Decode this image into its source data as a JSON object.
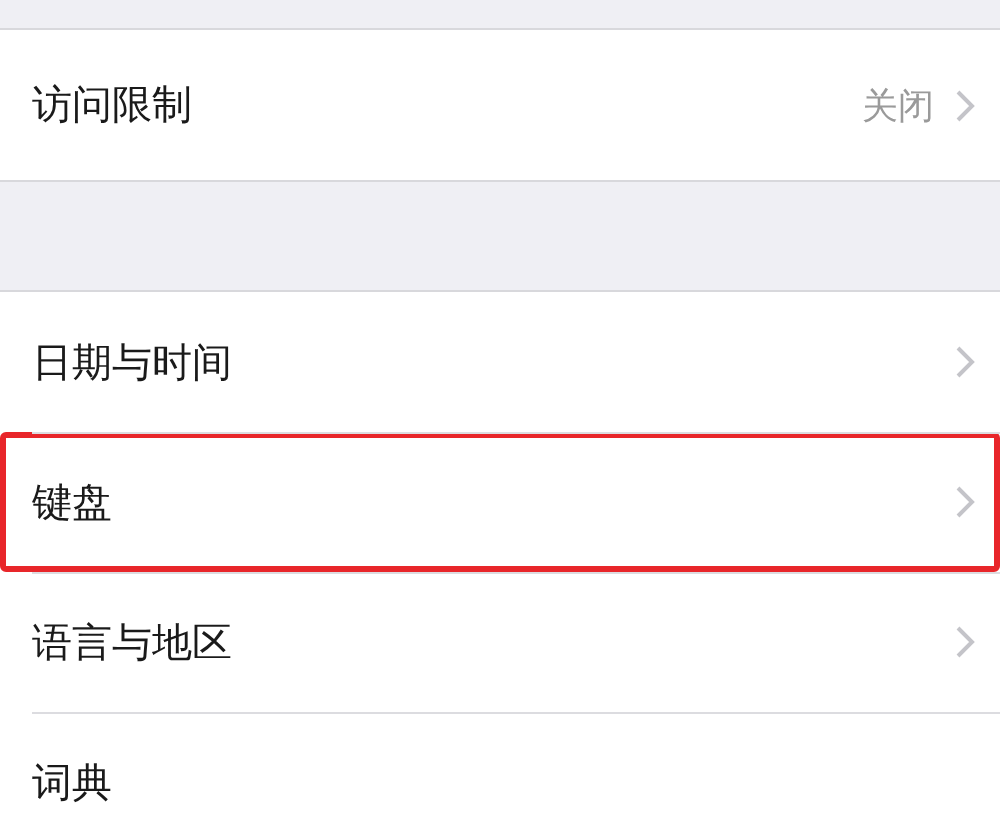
{
  "groups": [
    {
      "rows": [
        {
          "label": "访问限制",
          "value": "关闭",
          "chevron": true,
          "highlighted": false
        }
      ]
    },
    {
      "rows": [
        {
          "label": "日期与时间",
          "chevron": true,
          "highlighted": false
        },
        {
          "label": "键盘",
          "chevron": true,
          "highlighted": true
        },
        {
          "label": "语言与地区",
          "chevron": true,
          "highlighted": false
        },
        {
          "label": "词典",
          "chevron": false,
          "highlighted": false
        }
      ]
    }
  ]
}
